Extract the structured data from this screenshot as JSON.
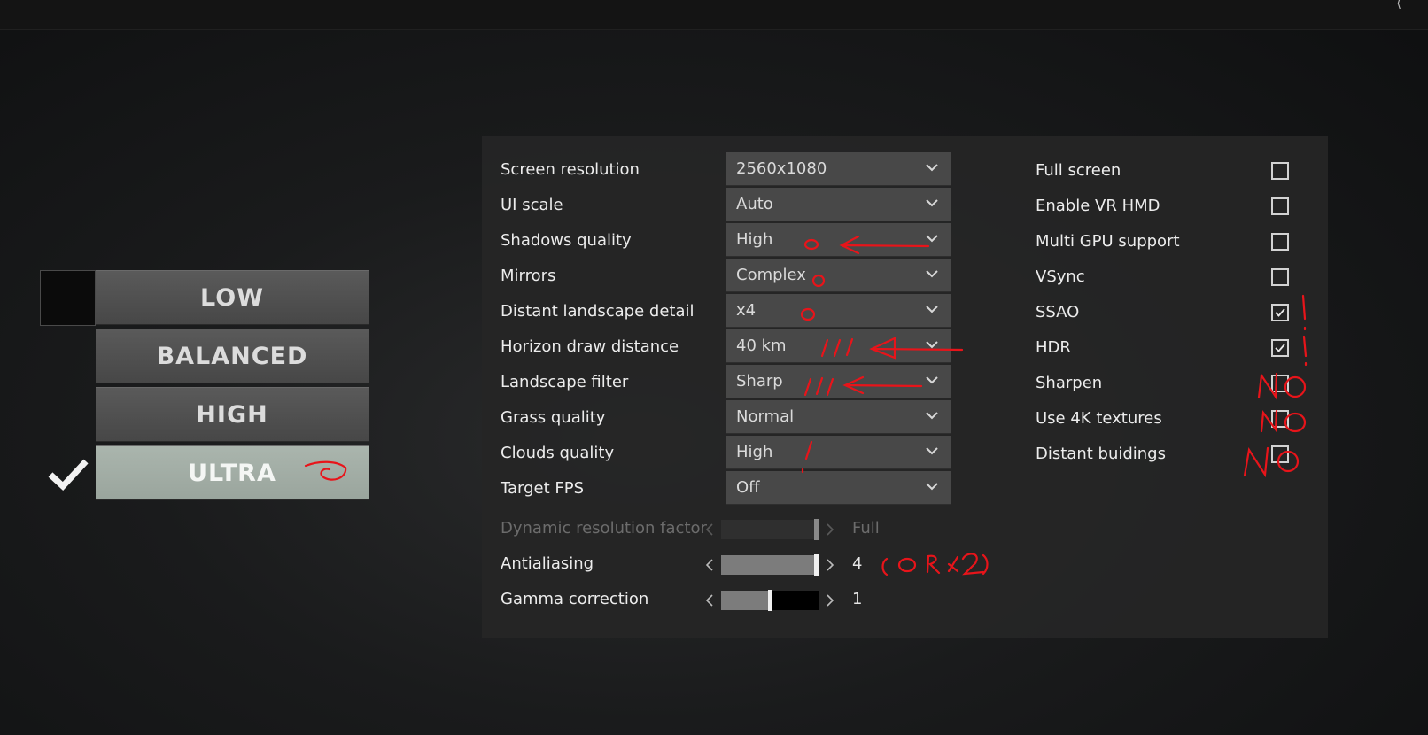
{
  "presets": [
    {
      "label": "LOW",
      "selected": false
    },
    {
      "label": "BALANCED",
      "selected": false
    },
    {
      "label": "HIGH",
      "selected": false
    },
    {
      "label": "ULTRA",
      "selected": true
    }
  ],
  "settings": [
    {
      "label": "Screen resolution",
      "value": "2560x1080"
    },
    {
      "label": "UI scale",
      "value": "Auto"
    },
    {
      "label": "Shadows quality",
      "value": "High"
    },
    {
      "label": "Mirrors",
      "value": "Complex"
    },
    {
      "label": "Distant landscape detail",
      "value": "x4"
    },
    {
      "label": "Horizon draw distance",
      "value": "40 km"
    },
    {
      "label": "Landscape filter",
      "value": "Sharp"
    },
    {
      "label": "Grass quality",
      "value": "Normal"
    },
    {
      "label": "Clouds quality",
      "value": "High"
    },
    {
      "label": "Target FPS",
      "value": "Off"
    }
  ],
  "sliders": [
    {
      "label": "Dynamic resolution factor",
      "value_text": "Full",
      "fraction": 1.0,
      "enabled": false
    },
    {
      "label": "Antialiasing",
      "value_text": "4",
      "fraction": 1.0,
      "enabled": true
    },
    {
      "label": "Gamma correction",
      "value_text": "1",
      "fraction": 0.5,
      "enabled": true
    }
  ],
  "toggles": [
    {
      "label": "Full screen",
      "checked": false
    },
    {
      "label": "Enable VR HMD",
      "checked": false
    },
    {
      "label": "Multi GPU support",
      "checked": false
    },
    {
      "label": "VSync",
      "checked": false
    },
    {
      "label": "SSAO",
      "checked": true
    },
    {
      "label": "HDR",
      "checked": true
    },
    {
      "label": "Sharpen",
      "checked": false
    },
    {
      "label": "Use 4K textures",
      "checked": false
    },
    {
      "label": "Distant buidings",
      "checked": false
    }
  ],
  "annotations": {
    "color": "#e8141a",
    "aa_note": "( OR x2 )",
    "no_text": "NO",
    "excl": "!"
  },
  "icons": {
    "check": "check-icon",
    "chevron": "chevron-down-icon",
    "left": "arrow-left-icon",
    "right": "arrow-right-icon"
  },
  "colors": {
    "panel": "#262626",
    "preset_button": "#515151",
    "preset_active": "#a5b0a8",
    "dropdown": "#484848"
  }
}
